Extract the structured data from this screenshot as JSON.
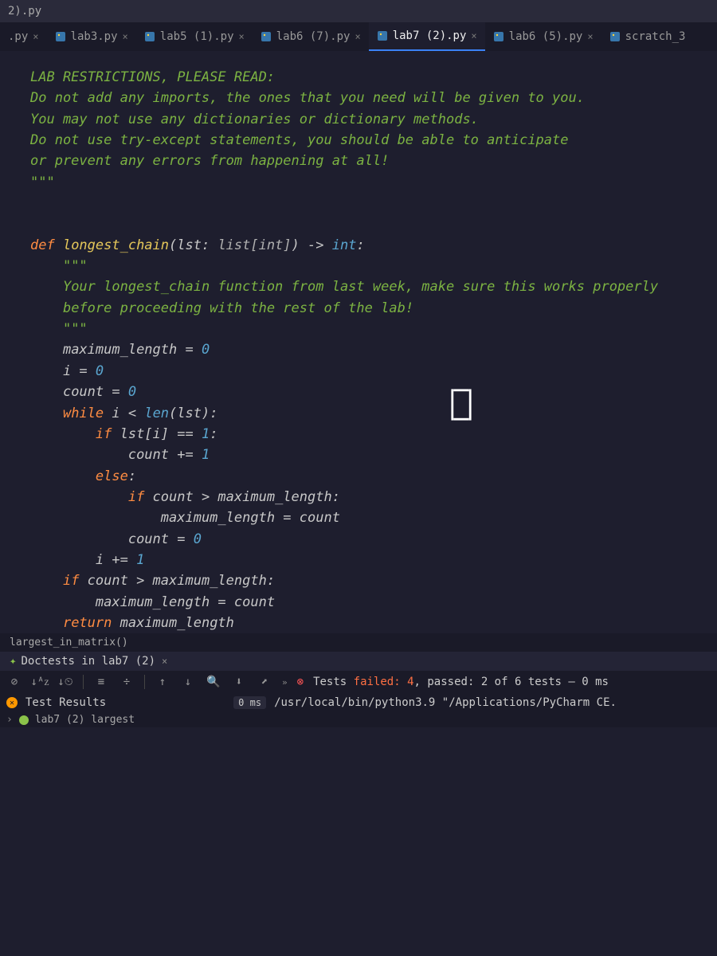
{
  "breadcrumb": {
    "file_label": "2).py"
  },
  "tabs": [
    {
      "label": ".py",
      "active": false
    },
    {
      "label": "lab3.py",
      "active": false
    },
    {
      "label": "lab5 (1).py",
      "active": false
    },
    {
      "label": "lab6 (7).py",
      "active": false
    },
    {
      "label": "lab7 (2).py",
      "active": true
    },
    {
      "label": "lab6 (5).py",
      "active": false
    },
    {
      "label": "scratch_3",
      "active": false
    }
  ],
  "code": {
    "docstring1": "LAB RESTRICTIONS, PLEASE READ:",
    "docstring2": "Do not add any imports, the ones that you need will be given to you.",
    "docstring3": "You may not use any dictionaries or dictionary methods.",
    "docstring4": "Do not use try-except statements, you should be able to anticipate",
    "docstring5": "or prevent any errors from happening at all!",
    "triple_quote": "\"\"\"",
    "def_kw": "def ",
    "func_name": "longest_chain",
    "sig_open": "(lst: ",
    "sig_type": "list[int]",
    "sig_close": ") -> ",
    "ret_type": "int",
    "colon": ":",
    "fn_doc1": "Your longest_chain function from last week, make sure this works properly",
    "fn_doc2": "before proceeding with the rest of the lab!",
    "l1": "maximum_length = ",
    "zero": "0",
    "l2": "i = ",
    "l3": "count = ",
    "while_kw": "while ",
    "l4": "i < ",
    "len_kw": "len",
    "l4b": "(lst):",
    "if_kw": "if ",
    "l5": "lst[i] == ",
    "one": "1",
    "l6": "count += ",
    "else_kw": "else",
    "l7": "count > maximum_length:",
    "l8": "maximum_length = count",
    "l9": "count = ",
    "l10": "i += ",
    "l11": "count > maximum_length:",
    "l12": "maximum_length = count",
    "return_kw": "return ",
    "l13": "maximum_length"
  },
  "breadcrumb2": "largest_in_matrix()",
  "run_panel": {
    "title": "Doctests in lab7 (2)"
  },
  "test_summary": {
    "prefix": "Tests ",
    "failed_label": "failed: ",
    "failed_count": "4",
    "passed_label": ", passed: ",
    "passed_count": "2",
    "total_label": " of 6 tests – ",
    "time": "0 ms"
  },
  "test_results": {
    "label": "Test Results",
    "timing": "0 ms",
    "path": "/usr/local/bin/python3.9 \"/Applications/PyCharm CE."
  },
  "last_row": {
    "label": "lab7 (2) largest"
  }
}
